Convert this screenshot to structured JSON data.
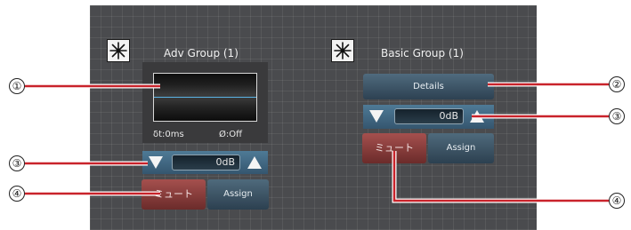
{
  "adv_group": {
    "title": "Adv Group (1)",
    "delay_label": "δt:0ms",
    "phase_label": "Ø:Off",
    "level_value": "0dB",
    "mute_label": "ミュート",
    "assign_label": "Assign"
  },
  "basic_group": {
    "title": "Basic Group (1)",
    "details_label": "Details",
    "level_value": "0dB",
    "mute_label": "ミュート",
    "assign_label": "Assign"
  },
  "callouts": {
    "c1": "①",
    "c2": "②",
    "c3_left": "③",
    "c3_right": "③",
    "c4_left": "④",
    "c4_right": "④"
  },
  "colors": {
    "callout_line": "#c9232b",
    "mute_button": "#8a3c3b",
    "accent_blue": "#4e7a96"
  }
}
